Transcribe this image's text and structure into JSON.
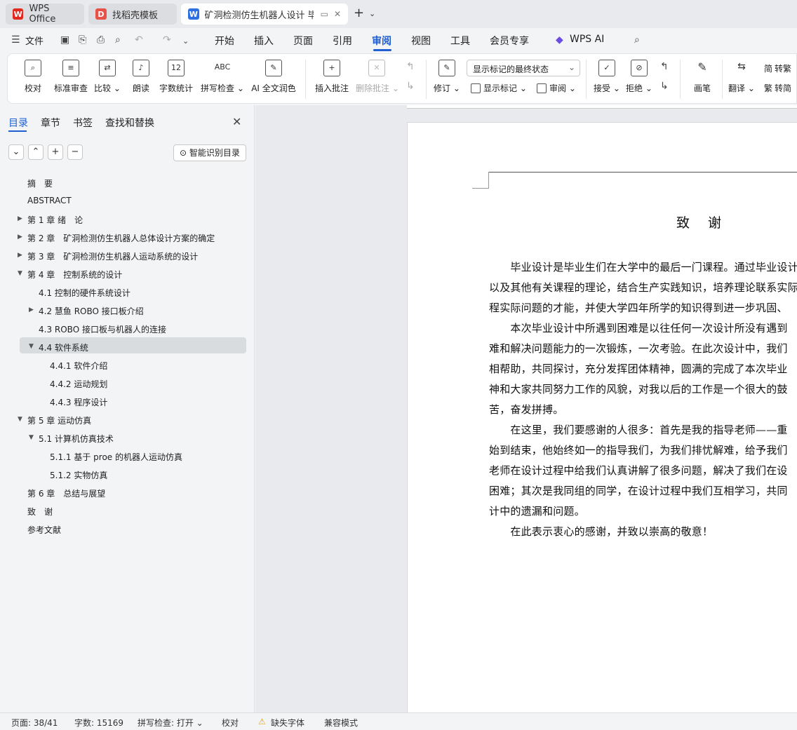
{
  "tabs": [
    {
      "label": "WPS Office",
      "logo": "wps-logo-icon",
      "logo_color": "#e2291f"
    },
    {
      "label": "找稻壳模板",
      "logo": "docer-logo-icon",
      "logo_color": "#e8504a"
    },
    {
      "label": "矿洞检测仿生机器人设计 毕业",
      "logo": "word-doc-icon",
      "logo_color": "#2f6fe4"
    }
  ],
  "menu": {
    "file": "文件",
    "items": [
      "开始",
      "插入",
      "页面",
      "引用",
      "审阅",
      "视图",
      "工具",
      "会员专享"
    ],
    "active": "审阅",
    "wps_ai": "WPS AI"
  },
  "ribbon": {
    "proofread": "校对",
    "standard_review": "标准审查",
    "compare": "比较",
    "read_aloud": "朗读",
    "word_count": "字数统计",
    "spell_check": "拼写检查",
    "ai_polish": "AI 全文润色",
    "insert_comment": "插入批注",
    "delete_comment": "删除批注",
    "track_changes": "修订",
    "markup_select": "显示标记的最终状态",
    "show_markup": "显示标记",
    "review": "审阅",
    "accept": "接受",
    "reject": "拒绝",
    "pen": "画笔",
    "translate": "翻译",
    "to_traditional": "转繁",
    "to_simplified": "转简"
  },
  "leftpanel": {
    "tabs": [
      "目录",
      "章节",
      "书签",
      "查找和替换"
    ],
    "active_tab": "目录",
    "smart_toc": "智能识别目录",
    "toc": [
      {
        "text": "摘　要",
        "level": 1,
        "arrow": ""
      },
      {
        "text": "ABSTRACT",
        "level": 1,
        "arrow": ""
      },
      {
        "text": "第 1 章  绪　论",
        "level": 1,
        "arrow": "collapsed"
      },
      {
        "text": "第 2 章　矿洞检测仿生机器人总体设计方案的确定",
        "level": 1,
        "arrow": "collapsed"
      },
      {
        "text": "第 3 章　矿洞检测仿生机器人运动系统的设计",
        "level": 1,
        "arrow": "collapsed"
      },
      {
        "text": "第 4 章　控制系统的设计",
        "level": 1,
        "arrow": "expanded"
      },
      {
        "text": "4.1 控制的硬件系统设计",
        "level": 2,
        "arrow": ""
      },
      {
        "text": "4.2 慧鱼  ROBO 接口板介绍",
        "level": 2,
        "arrow": "collapsed"
      },
      {
        "text": "4.3 ROBO 接口板与机器人的连接",
        "level": 2,
        "arrow": ""
      },
      {
        "text": "4.4 软件系统",
        "level": 2,
        "arrow": "expanded",
        "selected": true
      },
      {
        "text": "4.4.1 软件介绍",
        "level": 3,
        "arrow": ""
      },
      {
        "text": "4.4.2 运动规划",
        "level": 3,
        "arrow": ""
      },
      {
        "text": "4.4.3 程序设计",
        "level": 3,
        "arrow": ""
      },
      {
        "text": "第 5 章  运动仿真",
        "level": 1,
        "arrow": "expanded"
      },
      {
        "text": "5.1 计算机仿真技术",
        "level": 2,
        "arrow": "expanded"
      },
      {
        "text": "5.1.1 基于 proe 的机器人运动仿真",
        "level": 3,
        "arrow": ""
      },
      {
        "text": "5.1.2 实物仿真",
        "level": 3,
        "arrow": ""
      },
      {
        "text": "第 6 章　总结与展望",
        "level": 1,
        "arrow": ""
      },
      {
        "text": "致　谢",
        "level": 1,
        "arrow": ""
      },
      {
        "text": "参考文献",
        "level": 1,
        "arrow": ""
      }
    ]
  },
  "document": {
    "title": "致 谢",
    "lines": [
      "　　毕业设计是毕业生们在大学中的最后一门课程。通过毕业设计",
      "以及其他有关课程的理论，结合生产实践知识，培养理论联系实际",
      "程实际问题的才能，并使大学四年所学的知识得到进一步巩固、",
      "　　本次毕业设计中所遇到困难是以往任何一次设计所没有遇到",
      "难和解决问题能力的一次锻炼，一次考验。在此次设计中，我们",
      "相帮助，共同探讨，充分发挥团体精神，圆满的完成了本次毕业",
      "神和大家共同努力工作的风貌，对我以后的工作是一个很大的鼓",
      "苦，奋发拼搏。",
      "　　在这里，我们要感谢的人很多：首先是我的指导老师——重",
      "始到结束，他始终如一的指导我们，为我们排忧解难，给予我们",
      "老师在设计过程中给我们认真讲解了很多问题，解决了我们在设",
      "困难；其次是我同组的同学，在设计过程中我们互相学习，共同",
      "计中的遗漏和问题。",
      "　　在此表示衷心的感谢，并致以崇高的敬意！"
    ]
  },
  "status": {
    "page": "页面: 38/41",
    "words": "字数: 15169",
    "spell": "拼写检查: 打开",
    "proof": "校对",
    "missing_font": "缺失字体",
    "compat": "兼容模式"
  }
}
